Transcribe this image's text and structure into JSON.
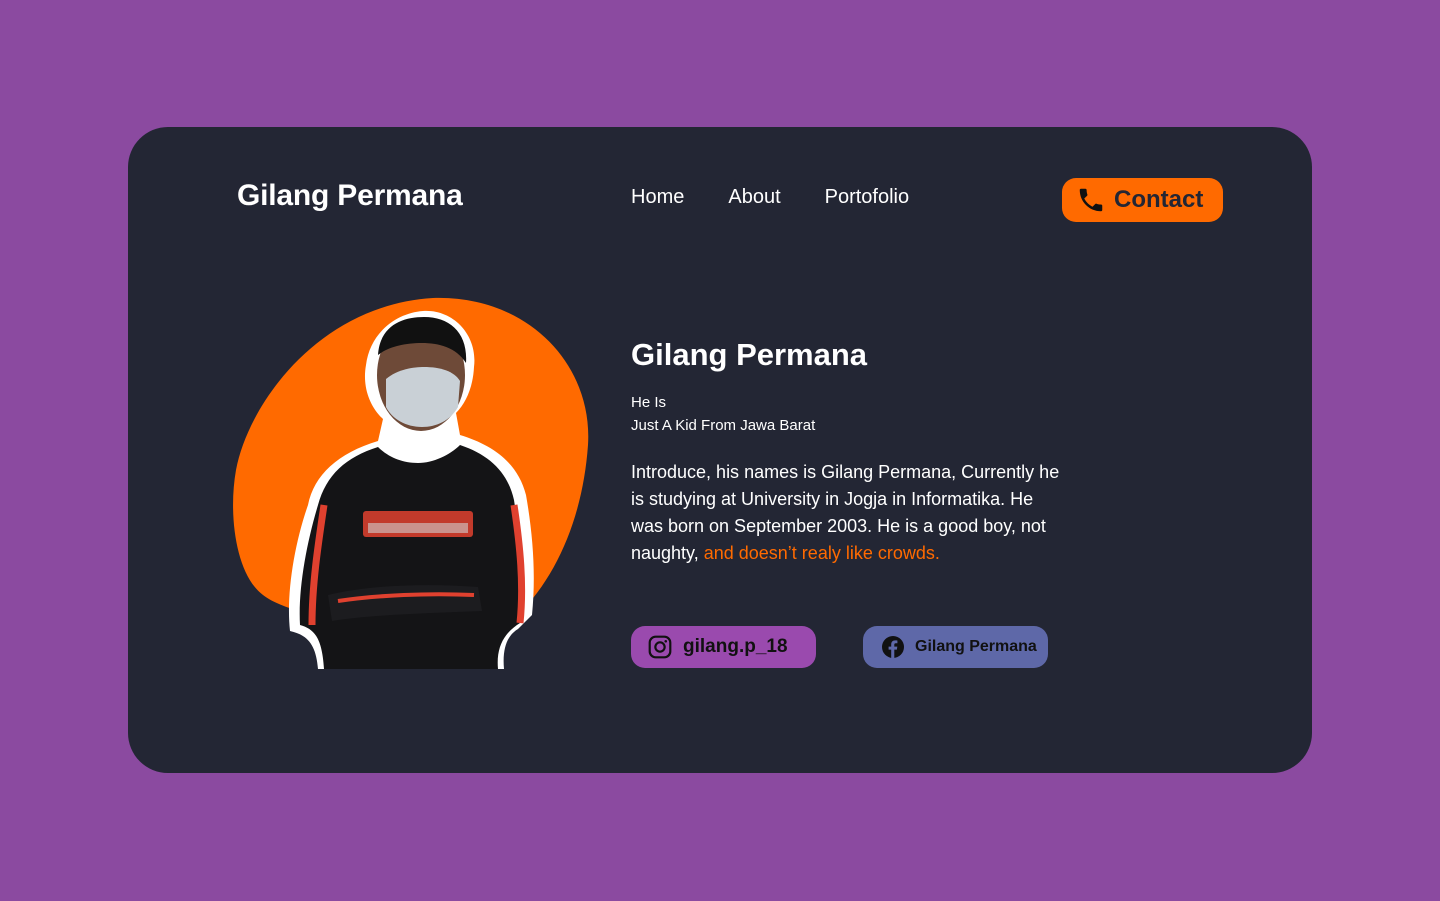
{
  "header": {
    "brand": "Gilang Permana",
    "nav": [
      "Home",
      "About",
      "Portofolio"
    ],
    "contact_label": "Contact"
  },
  "profile": {
    "name": "Gilang Permana",
    "tagline_1": "He Is",
    "tagline_2": "Just A Kid From Jawa Barat",
    "bio_plain": "Introduce, his names is Gilang Permana, Currently he is studying at University in Jogja in Informatika. He was born on September 2003. He is a good boy, not naughty, ",
    "bio_highlight": "and doesn’t realy like crowds."
  },
  "social": {
    "instagram": "gilang.p_18",
    "facebook": "Gilang Permana"
  },
  "colors": {
    "background": "#8b4aa0",
    "card": "#232634",
    "accent": "#ff6a00",
    "instagram_pill": "#9a4aae",
    "facebook_pill": "#5e68a8"
  },
  "icons": {
    "contact": "phone-icon",
    "instagram": "instagram-icon",
    "facebook": "facebook-icon"
  }
}
